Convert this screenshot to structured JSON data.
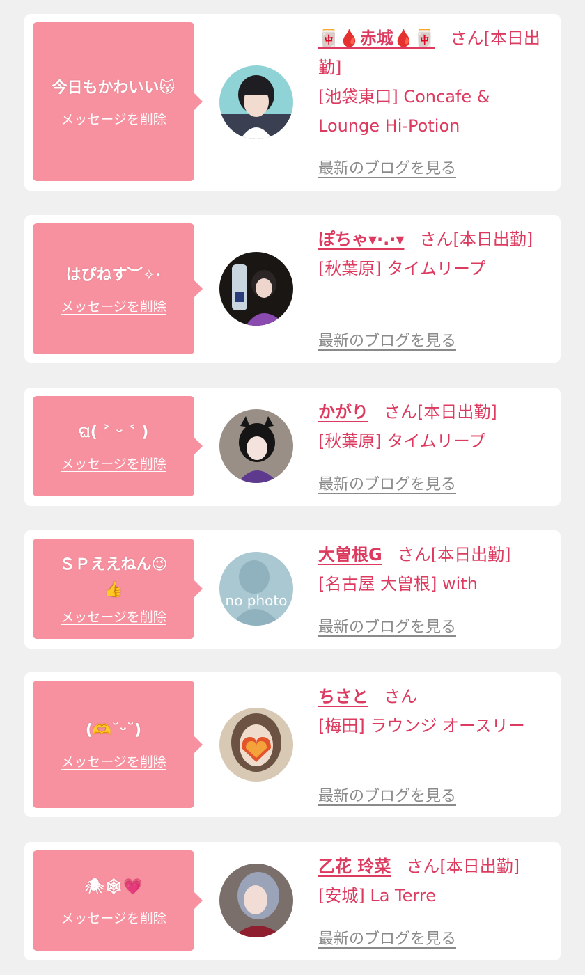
{
  "delete_label": "メッセージを削除",
  "blog_label": "最新のブログを見る",
  "colors": {
    "page_bg": "#f0f0f0",
    "card_bg": "#ffffff",
    "bubble": "#f8919f",
    "accent": "#dd3a5f",
    "link_gray": "#8a8a8a"
  },
  "entries": [
    {
      "message": "今日もかわいい😽",
      "name": "🀄🩸赤城🩸🀄",
      "suffix": "さん[本日出勤]",
      "shop": "[池袋東口] Concafe & Lounge Hi-Potion",
      "avatar_icon": "person-photo-avatar"
    },
    {
      "message": "はぴねす︶✧·",
      "name": "ぽちゃ▾·.·▾",
      "suffix": "さん[本日出勤]",
      "shop": "[秋葉原] タイムリープ",
      "avatar_icon": "person-photo-avatar"
    },
    {
      "message": "ଘ( ˃ ᵕ ˂ )",
      "name": "かがり",
      "suffix": "さん[本日出勤]",
      "shop": "[秋葉原] タイムリープ",
      "avatar_icon": "person-photo-avatar"
    },
    {
      "message": "ＳＰええねん😉\n👍",
      "name": "大曽根G",
      "suffix": "さん[本日出勤]",
      "shop": "[名古屋 大曽根] with",
      "avatar_icon": "no-photo-avatar",
      "avatar_text": "no photo"
    },
    {
      "message": "(🫶˘ᵕ˘)",
      "name": "ちさと",
      "suffix": "さん",
      "shop": "[梅田] ラウンジ オースリー",
      "avatar_icon": "person-photo-avatar"
    },
    {
      "message": "🕷🕸💗",
      "name": "乙花 玲菜",
      "suffix": "さん[本日出勤]",
      "shop": "[安城] La Terre",
      "avatar_icon": "person-photo-avatar"
    }
  ]
}
